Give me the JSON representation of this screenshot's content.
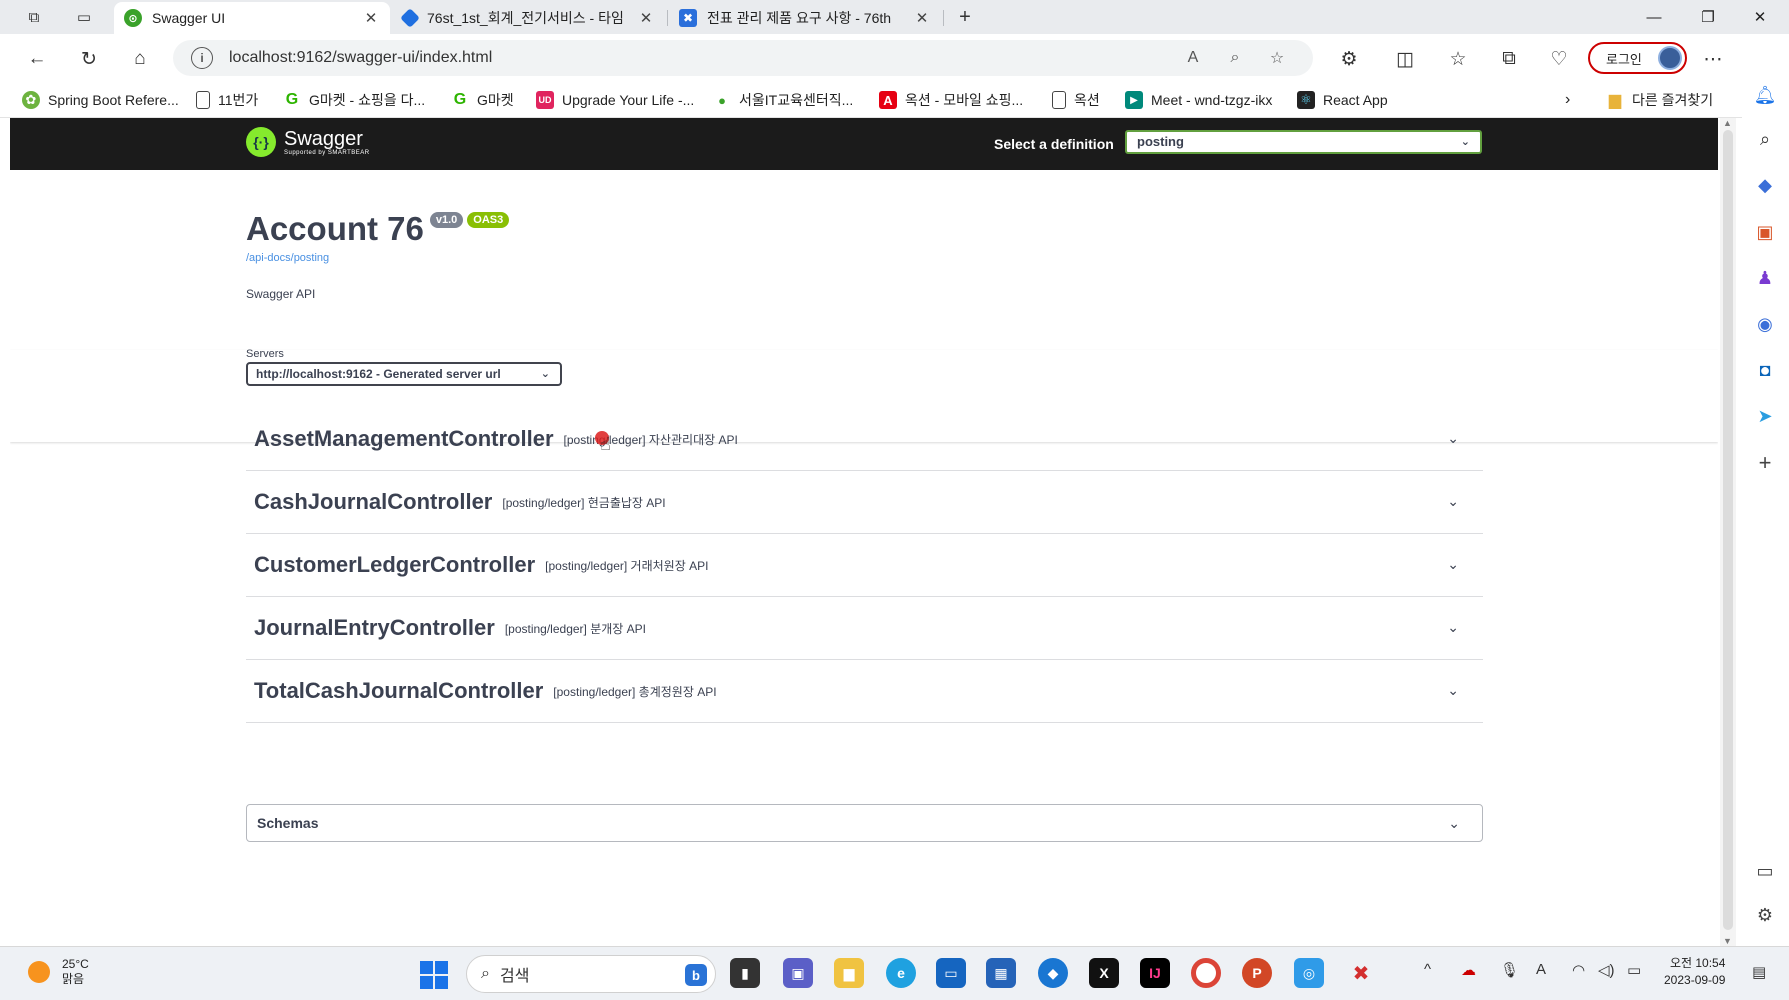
{
  "browser": {
    "tabs": [
      {
        "title": "Swagger UI",
        "active": true,
        "icon": "swagger-icon"
      },
      {
        "title": "76st_1st_회계_전기서비스 - 타임",
        "active": false,
        "icon": "jira-icon"
      },
      {
        "title": "전표 관리 제품 요구 사항 - 76th",
        "active": false,
        "icon": "confluence-icon"
      }
    ],
    "url": "localhost:9162/swagger-ui/index.html",
    "login_label": "로그인",
    "bookmarks": [
      {
        "label": "Spring Boot Refere...",
        "icon": "spring-icon"
      },
      {
        "label": "11번가",
        "icon": "page-icon"
      },
      {
        "label": "G마켓 - 쇼핑을 다...",
        "icon": "gmarket-icon"
      },
      {
        "label": "G마켓",
        "icon": "gmarket-icon"
      },
      {
        "label": "Upgrade Your Life -...",
        "icon": "upgrade-icon"
      },
      {
        "label": "서울IT교육센터직...",
        "icon": "leaf-icon"
      },
      {
        "label": "옥션 - 모바일 쇼핑...",
        "icon": "auction-icon"
      },
      {
        "label": "옥션",
        "icon": "page-icon"
      },
      {
        "label": "Meet - wnd-tzgz-ikx",
        "icon": "meet-icon"
      },
      {
        "label": "React App",
        "icon": "react-icon"
      }
    ],
    "other_bookmarks": "다른 즐겨찾기"
  },
  "swagger": {
    "logo_text": "Swagger",
    "logo_sub": "Supported by SMARTBEAR",
    "definition_label": "Select a definition",
    "definition_value": "posting",
    "title": "Account 76",
    "version": "v1.0",
    "oas": "OAS3",
    "spec_url": "/api-docs/posting",
    "description": "Swagger API",
    "servers_label": "Servers",
    "server_value": "http://localhost:9162 - Generated server url",
    "controllers": [
      {
        "name": "AssetManagementController",
        "desc": "[posting/ledger] 자산관리대장 API"
      },
      {
        "name": "CashJournalController",
        "desc": "[posting/ledger] 현금출납장 API"
      },
      {
        "name": "CustomerLedgerController",
        "desc": "[posting/ledger] 거래처원장 API"
      },
      {
        "name": "JournalEntryController",
        "desc": "[posting/ledger] 분개장 API"
      },
      {
        "name": "TotalCashJournalController",
        "desc": "[posting/ledger] 총계정원장 API"
      }
    ],
    "schemas_label": "Schemas"
  },
  "taskbar": {
    "temperature": "25°C",
    "weather": "맑음",
    "search_placeholder": "검색",
    "time": "오전 10:54",
    "date": "2023-09-09"
  },
  "colors": {
    "swagger_green": "#85ea2d",
    "topbar": "#1b1b1b",
    "definition_border": "#62a03f",
    "badge_version": "#7d8492",
    "badge_oas": "#89bf04"
  }
}
